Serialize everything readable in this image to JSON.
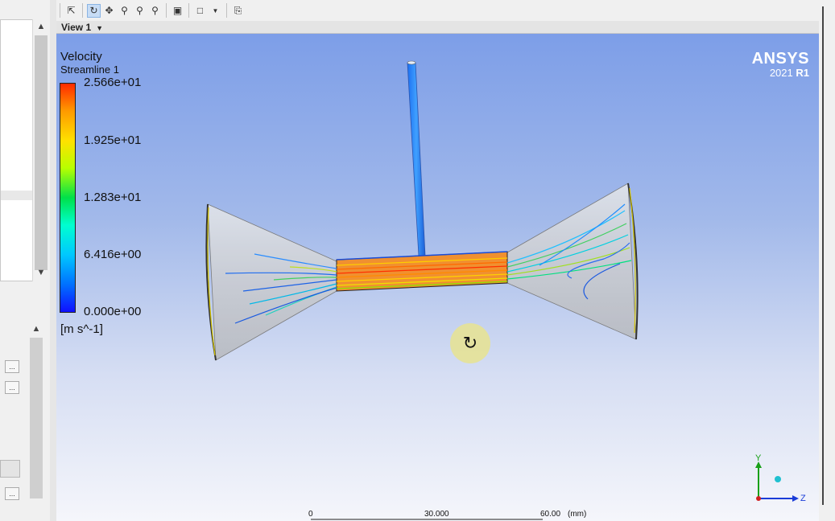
{
  "toolbar": {
    "icons": [
      "select-icon",
      "rotate-icon",
      "pan-icon",
      "zoom-icon",
      "zoom-box-icon",
      "zoom-fit-icon",
      "fit-view-icon",
      "viewport-layout-icon",
      "dropdown-icon",
      "highlight-icon"
    ]
  },
  "view": {
    "tab_label": "View 1"
  },
  "legend": {
    "variable": "Velocity",
    "object": "Streamline 1",
    "ticks": [
      "2.566e+01",
      "1.925e+01",
      "1.283e+01",
      "6.416e+00",
      "0.000e+00"
    ],
    "unit": "[m s^-1]",
    "colors": [
      "#ff2a00",
      "#ffe100",
      "#00e04a",
      "#00c8ff",
      "#1010ff"
    ]
  },
  "brand": {
    "name": "ANSYS",
    "version_year": "2021",
    "version_release": "R1"
  },
  "scale": {
    "labels": [
      "0",
      "30.000",
      "60.00"
    ],
    "unit": "(mm)"
  },
  "axes": {
    "y_label": "Y",
    "z_label": "Z"
  }
}
